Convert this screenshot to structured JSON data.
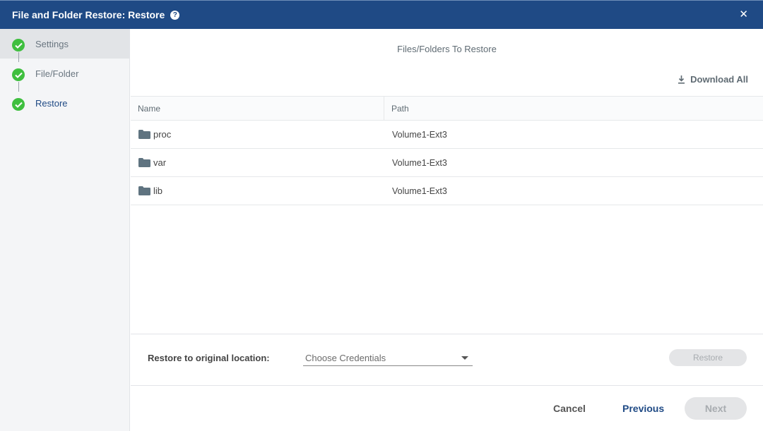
{
  "titlebar": {
    "title": "File and Folder Restore: Restore",
    "help_glyph": "?",
    "close_glyph": "✕"
  },
  "steps": [
    {
      "label": "Settings",
      "icon": "check-circle-icon"
    },
    {
      "label": "File/Folder",
      "icon": "check-circle-icon"
    },
    {
      "label": "Restore",
      "icon": "check-circle-icon"
    }
  ],
  "main": {
    "heading": "Files/Folders To Restore",
    "download_all": "Download All",
    "columns": {
      "name": "Name",
      "path": "Path"
    },
    "rows": [
      {
        "name": "proc",
        "path": "Volume1-Ext3",
        "icon": "folder-icon"
      },
      {
        "name": "var",
        "path": "Volume1-Ext3",
        "icon": "folder-icon"
      },
      {
        "name": "lib",
        "path": "Volume1-Ext3",
        "icon": "folder-icon"
      }
    ]
  },
  "restore": {
    "label": "Restore to original location:",
    "credentials_placeholder": "Choose Credentials",
    "button": "Restore"
  },
  "footer": {
    "cancel": "Cancel",
    "previous": "Previous",
    "next": "Next"
  },
  "colors": {
    "titlebar": "#1f4a85",
    "check": "#3fbf3f",
    "folder": "#5f7380"
  }
}
